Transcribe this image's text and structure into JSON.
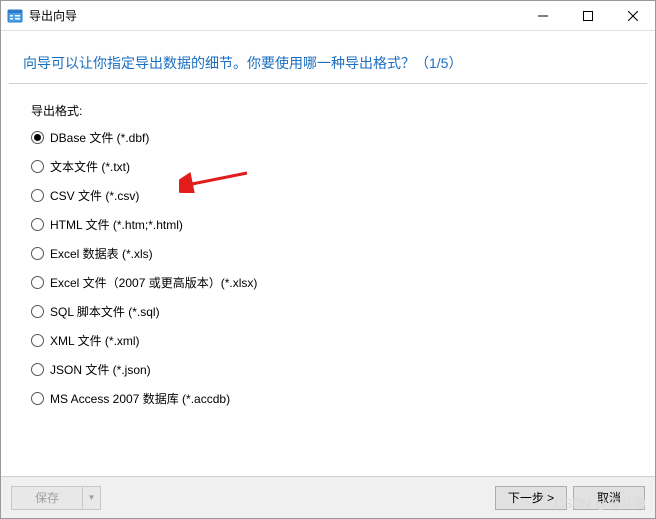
{
  "titlebar": {
    "title": "导出向导"
  },
  "heading": "向导可以让你指定导出数据的细节。你要使用哪一种导出格式？（1/5）",
  "form": {
    "label": "导出格式:",
    "options": [
      {
        "label": "DBase 文件 (*.dbf)",
        "selected": true
      },
      {
        "label": "文本文件 (*.txt)",
        "selected": false
      },
      {
        "label": "CSV 文件 (*.csv)",
        "selected": false
      },
      {
        "label": "HTML 文件 (*.htm;*.html)",
        "selected": false
      },
      {
        "label": "Excel 数据表 (*.xls)",
        "selected": false
      },
      {
        "label": "Excel 文件（2007 或更高版本）(*.xlsx)",
        "selected": false
      },
      {
        "label": "SQL 脚本文件 (*.sql)",
        "selected": false
      },
      {
        "label": "XML 文件 (*.xml)",
        "selected": false
      },
      {
        "label": "JSON 文件 (*.json)",
        "selected": false
      },
      {
        "label": "MS Access 2007 数据库 (*.accdb)",
        "selected": false
      }
    ]
  },
  "footer": {
    "save": "保存",
    "next": "下一步 >",
    "cancel": "取消"
  },
  "watermark": "CSDN @奋斗鱼"
}
